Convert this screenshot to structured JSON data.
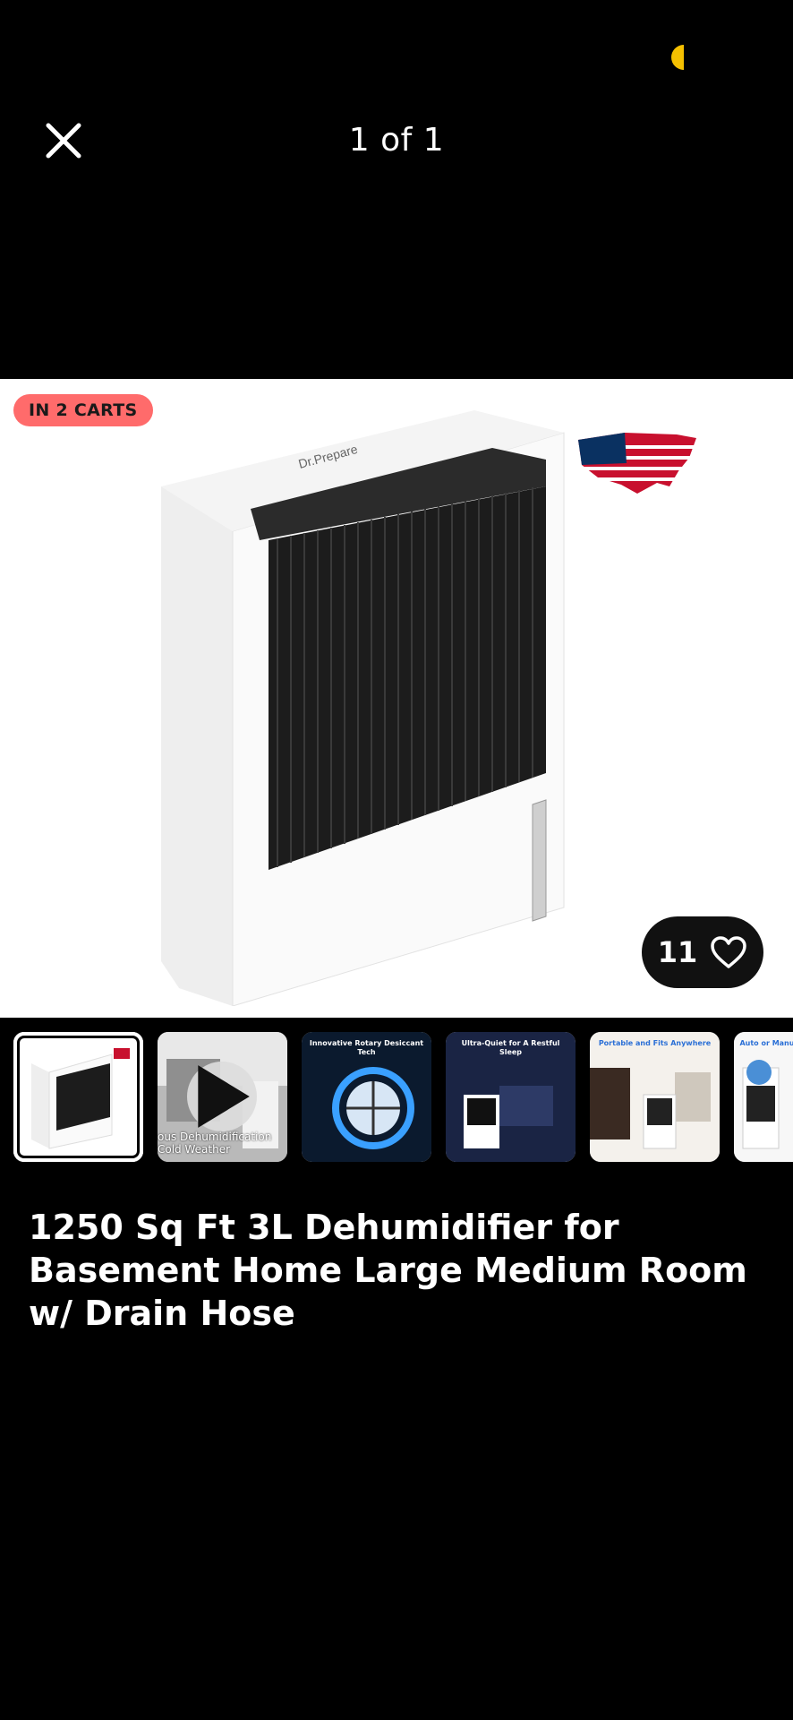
{
  "header": {
    "counter": "1 of 1"
  },
  "hero": {
    "cart_badge": "IN 2 CARTS",
    "brand_logo": "Dr.Prepare",
    "like_count": "11"
  },
  "thumbnails": {
    "items": [
      {
        "type": "image",
        "selected": true
      },
      {
        "type": "video",
        "overlay_text_1": "ous Dehumidification",
        "overlay_text_2": "Cold Weather"
      },
      {
        "type": "image",
        "caption": "Innovative Rotary Desiccant Tech"
      },
      {
        "type": "image",
        "caption": "Ultra-Quiet for A Restful Sleep"
      },
      {
        "type": "image",
        "caption": "Portable and Fits Anywhere"
      },
      {
        "type": "image",
        "caption": "Auto or Manual It's Up to You"
      }
    ]
  },
  "product": {
    "title": "1250 Sq Ft 3L Dehumidifier for Basement Home Large Medium Room w/ Drain Hose"
  },
  "colors": {
    "background": "#000000",
    "cart_badge": "#ff6b6b",
    "status_indicator": "#f5c000"
  },
  "icons": [
    "close-icon",
    "heart-icon",
    "play-icon"
  ]
}
